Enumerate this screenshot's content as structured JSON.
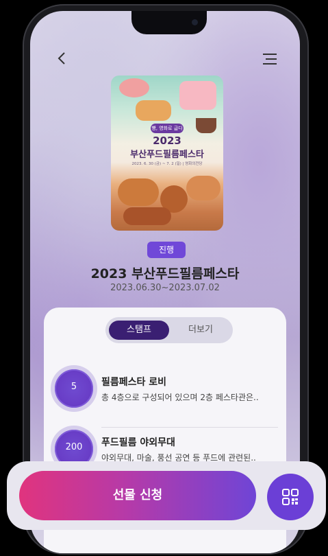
{
  "header": {
    "back_icon": "chevron-left-icon",
    "menu_icon": "menu-icon"
  },
  "event": {
    "status_badge": "진행",
    "title": "2023 부산푸드필름페스타",
    "dates": "2023.06.30~2023.07.02"
  },
  "poster": {
    "tagline": "빵, 영화로 굽다",
    "year": "2023",
    "title": "부산푸드필름페스타",
    "dates": "2023. 6. 30 (금) ~ 7. 2 (일) | 영화의전당"
  },
  "tabs": [
    {
      "label": "스탬프",
      "active": true
    },
    {
      "label": "더보기",
      "active": false
    }
  ],
  "stamps": [
    {
      "number": "5",
      "title": "필름페스타 로비",
      "description": "총 4층으로 구성되어 있으며 2층 페스타관은.."
    },
    {
      "number": "200",
      "title": "푸드필름 야외무대",
      "description": "야외무대, 마술, 풍선 공연 등 푸드에 관련된.."
    }
  ],
  "bottom": {
    "gift_button": "선물 신청",
    "qr_icon": "qr-code-icon"
  },
  "colors": {
    "accent": "#7048d8",
    "tab_active": "#3a1f72",
    "cta_start": "#e0347e",
    "cta_end": "#6f45d6"
  }
}
